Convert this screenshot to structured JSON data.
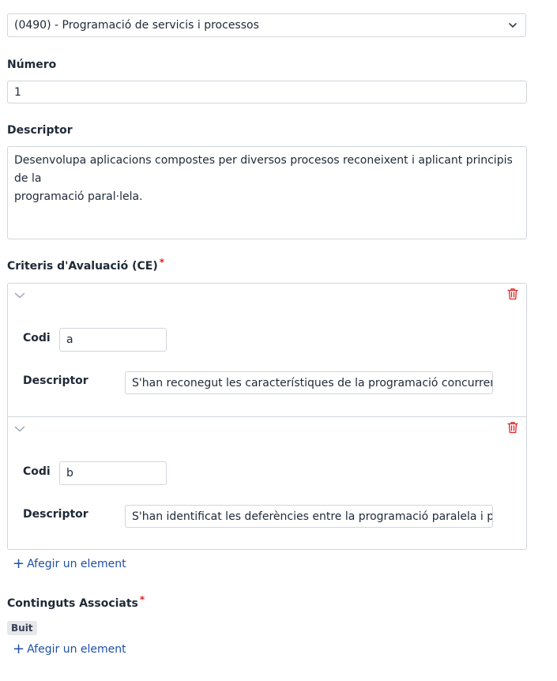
{
  "module_select": {
    "value": "(0490) - Programació de servicis i processos",
    "icon": "chevron-down-icon"
  },
  "numero": {
    "label": "Número",
    "value": "1"
  },
  "descriptor": {
    "label": "Descriptor",
    "lines": [
      "Desenvolupa aplicacions compostes per diversos procesos reconeixent i aplicant principis de la",
      "programació paral·lela."
    ]
  },
  "criteris": {
    "label": "Criteris d'Avaluació (CE)",
    "required_mark": "*",
    "items": [
      {
        "codi_label": "Codi",
        "codi_value": "a",
        "descriptor_label": "Descriptor",
        "descriptor_value": "S'han reconegut les característiques de la programació concurrent i els"
      },
      {
        "codi_label": "Codi",
        "codi_value": "b",
        "descriptor_label": "Descriptor",
        "descriptor_value": "S'han identificat les deferències entre la programació paralela  i prograi"
      }
    ],
    "add_label": "Afegir un element"
  },
  "continguts": {
    "label": "Continguts Associats",
    "required_mark": "*",
    "empty_badge": "Buit",
    "add_label": "Afegir un element"
  },
  "colors": {
    "danger": "#dc2626",
    "link": "#1e4fa8",
    "border": "#d1d5db"
  }
}
